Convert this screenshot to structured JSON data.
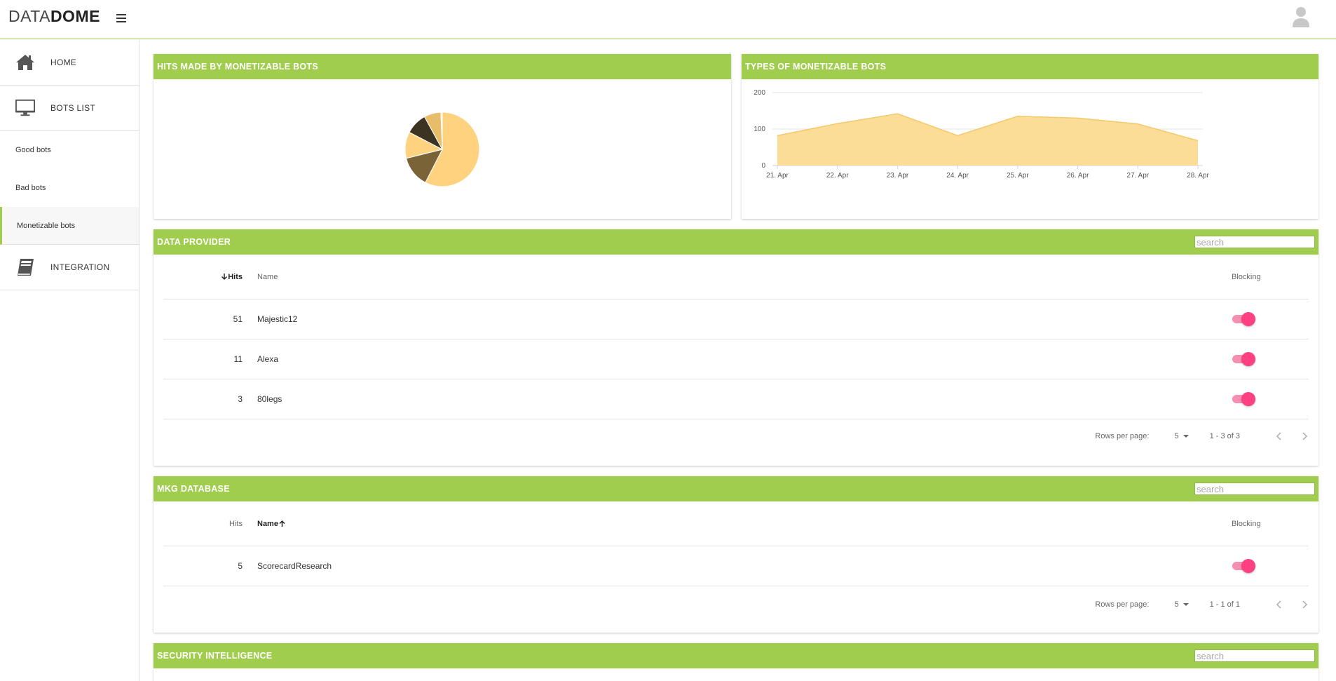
{
  "logo": {
    "part1": "DATA",
    "part2": "DOME"
  },
  "sidebar": {
    "home": "HOME",
    "bots_list": "BOTS LIST",
    "good_bots": "Good bots",
    "bad_bots": "Bad bots",
    "monetizable_bots": "Monetizable bots",
    "integration": "INTEGRATION"
  },
  "pie_card": {
    "title": "HITS MADE BY MONETIZABLE BOTS"
  },
  "area_card": {
    "title": "TYPES OF MONETIZABLE BOTS"
  },
  "colors": {
    "accent": "#a0cd4e",
    "toggle_on": "#ff4081",
    "area_fill": "#fcd98c"
  },
  "chart_data": [
    {
      "type": "pie",
      "slices": [
        {
          "value": 55,
          "color": "#ffd27f"
        },
        {
          "value": 13,
          "color": "#7a6336"
        },
        {
          "value": 11,
          "color": "#ffd27f"
        },
        {
          "value": 9,
          "color": "#3d3322"
        },
        {
          "value": 7,
          "color": "#e8bd6a"
        },
        {
          "value": 0.6,
          "color": "#fff0d2"
        }
      ]
    },
    {
      "type": "area",
      "x": [
        "21. Apr",
        "22. Apr",
        "23. Apr",
        "24. Apr",
        "25. Apr",
        "26. Apr",
        "27. Apr",
        "28. Apr"
      ],
      "values": [
        82,
        115,
        142,
        82,
        135,
        130,
        114,
        68
      ],
      "ylim": [
        0,
        200
      ],
      "yticks": [
        "0",
        "100",
        "200"
      ],
      "grid": true
    }
  ],
  "data_provider": {
    "title": "DATA PROVIDER",
    "search_placeholder": "search",
    "columns": {
      "hits": "Hits",
      "name": "Name",
      "blocking": "Blocking"
    },
    "rows": [
      {
        "hits": "51",
        "name": "Majestic12"
      },
      {
        "hits": "11",
        "name": "Alexa"
      },
      {
        "hits": "3",
        "name": "80legs"
      }
    ],
    "pager": {
      "rows_label": "Rows per page:",
      "rows_value": "5",
      "range": "1 - 3 of 3"
    }
  },
  "mkg_database": {
    "title": "MKG DATABASE",
    "search_placeholder": "search",
    "columns": {
      "hits": "Hits",
      "name": "Name",
      "blocking": "Blocking"
    },
    "rows": [
      {
        "hits": "5",
        "name": "ScorecardResearch"
      }
    ],
    "pager": {
      "rows_label": "Rows per page:",
      "rows_value": "5",
      "range": "1 - 1 of 1"
    }
  },
  "security_intelligence": {
    "title": "SECURITY INTELLIGENCE",
    "search_placeholder": "search"
  }
}
